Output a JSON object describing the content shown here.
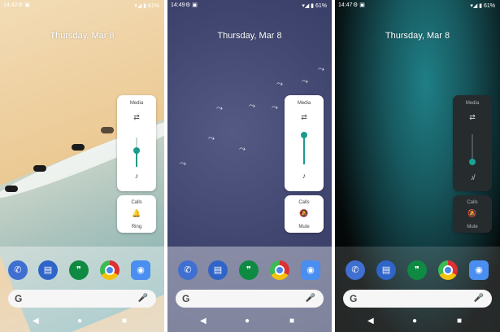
{
  "screens": [
    {
      "status": {
        "time": "14:42",
        "battery": "61%"
      },
      "date": "Thursday, Mar 8",
      "media": {
        "label": "Media",
        "level": 0.45
      },
      "calls": {
        "label": "Calls",
        "mode": "Ring"
      }
    },
    {
      "status": {
        "time": "14:49",
        "battery": "61%"
      },
      "date": "Thursday, Mar 8",
      "media": {
        "label": "Media",
        "level": 0.55
      },
      "calls": {
        "label": "Calls",
        "mode": "Mute"
      }
    },
    {
      "status": {
        "time": "14:47",
        "battery": "61%"
      },
      "date": "Thursday, Mar 8",
      "media": {
        "label": "Media",
        "level": 0.0
      },
      "calls": {
        "label": "Calls",
        "mode": "Mute"
      }
    }
  ],
  "dock_apps": [
    "phone-icon",
    "messages-icon",
    "hangouts-icon",
    "chrome-icon",
    "camera-icon"
  ],
  "colors": {
    "accent": "#1e9a8c",
    "dark_panel": "#262b2e"
  }
}
